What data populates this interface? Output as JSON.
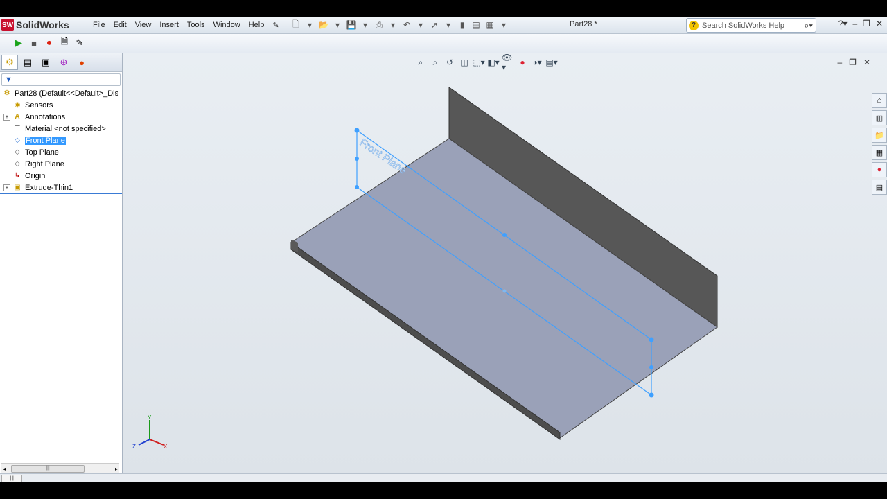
{
  "app": {
    "brand": "SolidWorks",
    "logo_mark": "SW",
    "document_title": "Part28 *"
  },
  "menu": {
    "items": [
      "File",
      "Edit",
      "View",
      "Insert",
      "Tools",
      "Window",
      "Help"
    ]
  },
  "search": {
    "placeholder": "Search SolidWorks Help"
  },
  "feature_tree": {
    "root": "Part28  (Default<<Default>_Dis",
    "items": [
      {
        "label": "Sensors",
        "icon": "sensor-icon",
        "expandable": false
      },
      {
        "label": "Annotations",
        "icon": "annotation-icon",
        "expandable": true
      },
      {
        "label": "Material <not specified>",
        "icon": "material-icon",
        "expandable": false
      },
      {
        "label": "Front Plane",
        "icon": "plane-icon",
        "expandable": false,
        "selected": true
      },
      {
        "label": "Top Plane",
        "icon": "plane-icon",
        "expandable": false
      },
      {
        "label": "Right Plane",
        "icon": "plane-icon",
        "expandable": false
      },
      {
        "label": "Origin",
        "icon": "origin-icon",
        "expandable": false
      },
      {
        "label": "Extrude-Thin1",
        "icon": "extrude-icon",
        "expandable": true
      }
    ]
  },
  "viewport": {
    "plane_label": "Front Plane",
    "triad_axes": [
      "Y",
      "Z",
      "X"
    ]
  },
  "colors": {
    "selection": "#3399ff",
    "plane_outline": "#3fa0ff",
    "model_face": "#9aa1b8",
    "model_wall": "#555555"
  }
}
